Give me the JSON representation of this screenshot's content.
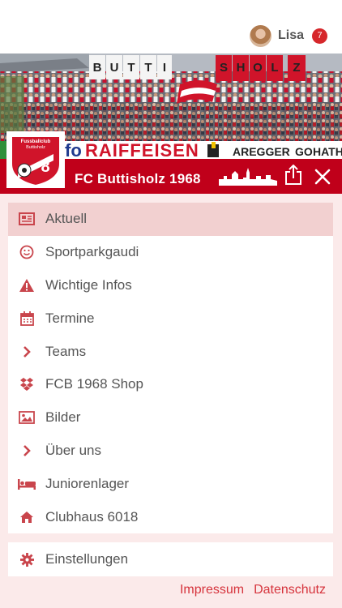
{
  "user": {
    "name": "Lisa",
    "notifications": "7"
  },
  "banner": {
    "flag_letters": [
      "B",
      "U",
      "T",
      "T",
      "I",
      "S",
      "H",
      "O",
      "L",
      "Z"
    ],
    "sponsors": [
      "RAIFFEISEN",
      "AREGGER",
      "GO",
      "HATH"
    ]
  },
  "club": {
    "name": "FC Buttisholz 1968",
    "logo_text_top": "Fussballclub",
    "logo_text_sub": "Buttisholz",
    "colors": {
      "primary": "#c0001a",
      "accent": "#d6333c"
    }
  },
  "menu": {
    "items": [
      {
        "label": "Aktuell",
        "icon": "newspaper-icon",
        "active": true
      },
      {
        "label": "Sportparkgaudi",
        "icon": "smiley-icon",
        "active": false
      },
      {
        "label": "Wichtige Infos",
        "icon": "warning-icon",
        "active": false
      },
      {
        "label": "Termine",
        "icon": "calendar-icon",
        "active": false
      },
      {
        "label": "Teams",
        "icon": "chevron-right-icon",
        "active": false
      },
      {
        "label": "FCB 1968 Shop",
        "icon": "dropbox-icon",
        "active": false
      },
      {
        "label": "Bilder",
        "icon": "image-icon",
        "active": false
      },
      {
        "label": "Über uns",
        "icon": "chevron-right-icon",
        "active": false
      },
      {
        "label": "Juniorenlager",
        "icon": "bed-icon",
        "active": false
      },
      {
        "label": "Clubhaus 6018",
        "icon": "home-icon",
        "active": false
      }
    ],
    "settings_label": "Einstellungen"
  },
  "footer": {
    "impressum": "Impressum",
    "datenschutz": "Datenschutz"
  }
}
